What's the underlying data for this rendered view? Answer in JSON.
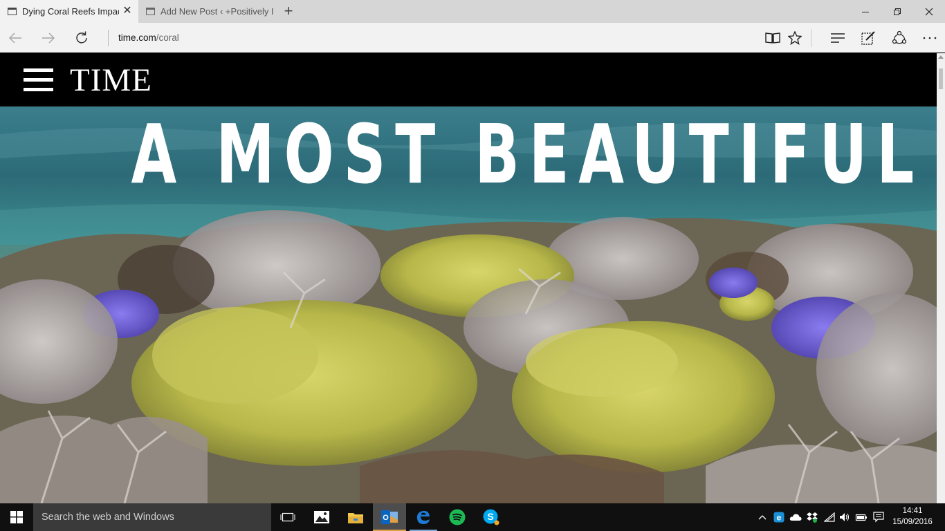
{
  "browser": {
    "tabs": [
      {
        "title": "Dying Coral Reefs Impac",
        "active": true
      },
      {
        "title": "Add New Post ‹ +Positively I",
        "active": false
      }
    ],
    "new_tab_label": "+",
    "address": {
      "domain": "time.com",
      "path": "/coral"
    }
  },
  "site": {
    "logo": "TIME",
    "headline": "A MOST BEAUTIFUL DEATH"
  },
  "taskbar": {
    "search_placeholder": "Search the web and Windows",
    "clock_time": "14:41",
    "clock_date": "15/09/2016",
    "pinned_apps": [
      "task-view",
      "photos",
      "file-explorer",
      "outlook",
      "edge",
      "spotify",
      "skype"
    ]
  },
  "colors": {
    "tabbar_bg": "#d6d6d6",
    "active_tab_bg": "#f2f2f2",
    "site_header_bg": "#000000",
    "taskbar_bg": "#101010",
    "search_bg": "#3a3a3a",
    "edge_blue": "#1e7bd6",
    "spotify_green": "#1db954",
    "skype_blue": "#00a9f0"
  }
}
